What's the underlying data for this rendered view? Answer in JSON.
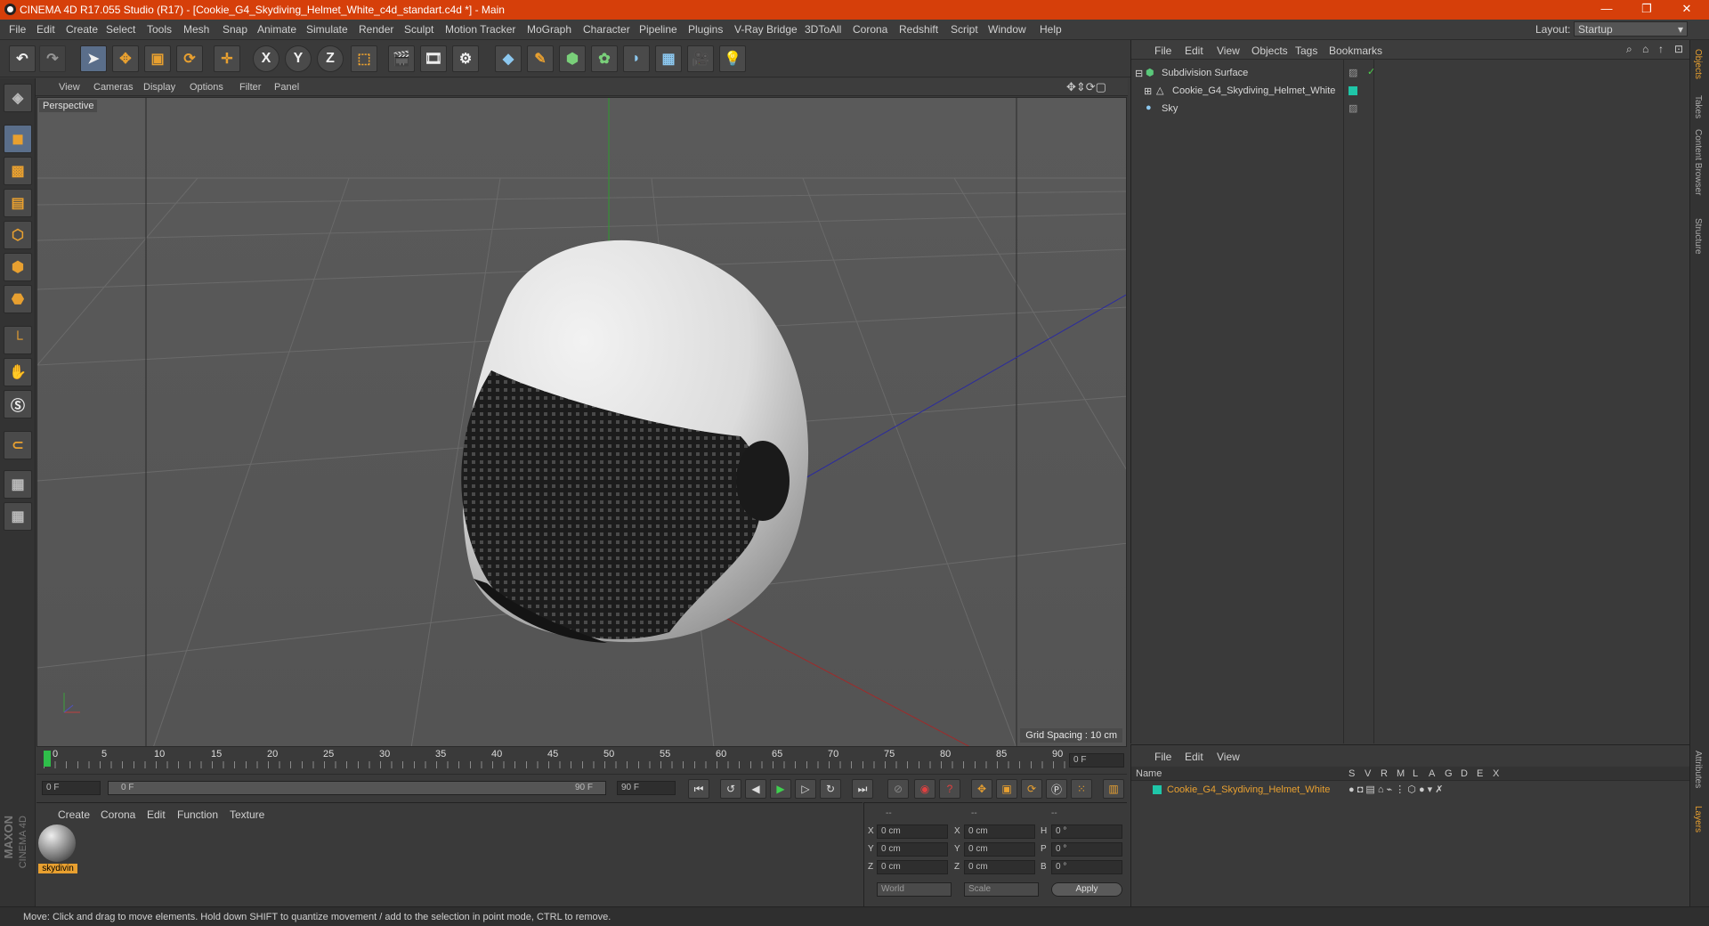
{
  "window": {
    "title": "CINEMA 4D R17.055 Studio (R17) - [Cookie_G4_Skydiving_Helmet_White_c4d_standart.c4d *] - Main",
    "minimize": "—",
    "restore": "❐",
    "close": "✕"
  },
  "menubar": {
    "items": [
      "File",
      "Edit",
      "Create",
      "Select",
      "Tools",
      "Mesh",
      "Snap",
      "Animate",
      "Simulate",
      "Render",
      "Sculpt",
      "Motion Tracker",
      "MoGraph",
      "Character",
      "Pipeline",
      "Plugins",
      "V-Ray Bridge",
      "3DToAll",
      "Corona",
      "Redshift",
      "Script",
      "Window",
      "Help"
    ],
    "layout_label": "Layout:",
    "layout_value": "Startup"
  },
  "toolbar": {
    "icons": [
      "undo-icon",
      "redo-icon",
      "select-icon",
      "move-icon",
      "scale-icon",
      "rotate-icon",
      "transform-icon",
      "x-axis-icon",
      "y-axis-icon",
      "z-axis-icon",
      "coord-system-icon",
      "render-view-icon",
      "render-picture-queue-icon",
      "render-settings-icon",
      "cube-icon",
      "pen-spline-icon",
      "subdivision-icon",
      "cloner-icon",
      "deformer-icon",
      "floor-icon",
      "camera-icon",
      "light-icon"
    ],
    "x": "X",
    "y": "Y",
    "z": "Z"
  },
  "viewport": {
    "menu": [
      "View",
      "Cameras",
      "Display",
      "Options",
      "Filter",
      "Panel"
    ],
    "label": "Perspective",
    "grid_spacing": "Grid Spacing : 10 cm"
  },
  "timeline": {
    "ticks": [
      "0",
      "5",
      "10",
      "15",
      "20",
      "25",
      "30",
      "35",
      "40",
      "45",
      "50",
      "55",
      "60",
      "65",
      "70",
      "75",
      "80",
      "85",
      "90"
    ],
    "current_frame": "0 F",
    "start": "0 F",
    "range_start": "0 F",
    "range_end": "90 F",
    "end": "90 F"
  },
  "material_panel": {
    "menu": [
      "Create",
      "Corona",
      "Edit",
      "Function",
      "Texture"
    ],
    "material_name": "skydivin"
  },
  "coord_panel": {
    "header": [
      "--",
      "--",
      "--"
    ],
    "rows": [
      {
        "a": "X",
        "v1": "0 cm",
        "b": "X",
        "v2": "0 cm",
        "c": "H",
        "v3": "0 °"
      },
      {
        "a": "Y",
        "v1": "0 cm",
        "b": "Y",
        "v2": "0 cm",
        "c": "P",
        "v3": "0 °"
      },
      {
        "a": "Z",
        "v1": "0 cm",
        "b": "Z",
        "v2": "0 cm",
        "c": "B",
        "v3": "0 °"
      }
    ],
    "world": "World",
    "scale": "Scale",
    "apply": "Apply"
  },
  "object_panel": {
    "menu": [
      "File",
      "Edit",
      "View",
      "Objects",
      "Tags",
      "Bookmarks"
    ],
    "objects": [
      "Subdivision Surface",
      "Cookie_G4_Skydiving_Helmet_White",
      "Sky"
    ]
  },
  "layer_panel": {
    "menu": [
      "File",
      "Edit",
      "View"
    ],
    "columns": [
      "Name",
      "S",
      "V",
      "R",
      "M",
      "L",
      "A",
      "G",
      "D",
      "E",
      "X"
    ],
    "layers": [
      "Cookie_G4_Skydiving_Helmet_White"
    ]
  },
  "side_tabs": [
    "Objects",
    "Takes",
    "Content Browser",
    "Structure",
    "Attributes",
    "Layers"
  ],
  "brand": {
    "maxon": "MAXON",
    "c4d": "CINEMA 4D"
  },
  "status": "Move: Click and drag to move elements. Hold down SHIFT to quantize movement / add to the selection in point mode, CTRL to remove.",
  "colors": {
    "title_bar": "#d63f0a",
    "accent": "#e8a030",
    "layer_teal": "#1fc6a8"
  }
}
